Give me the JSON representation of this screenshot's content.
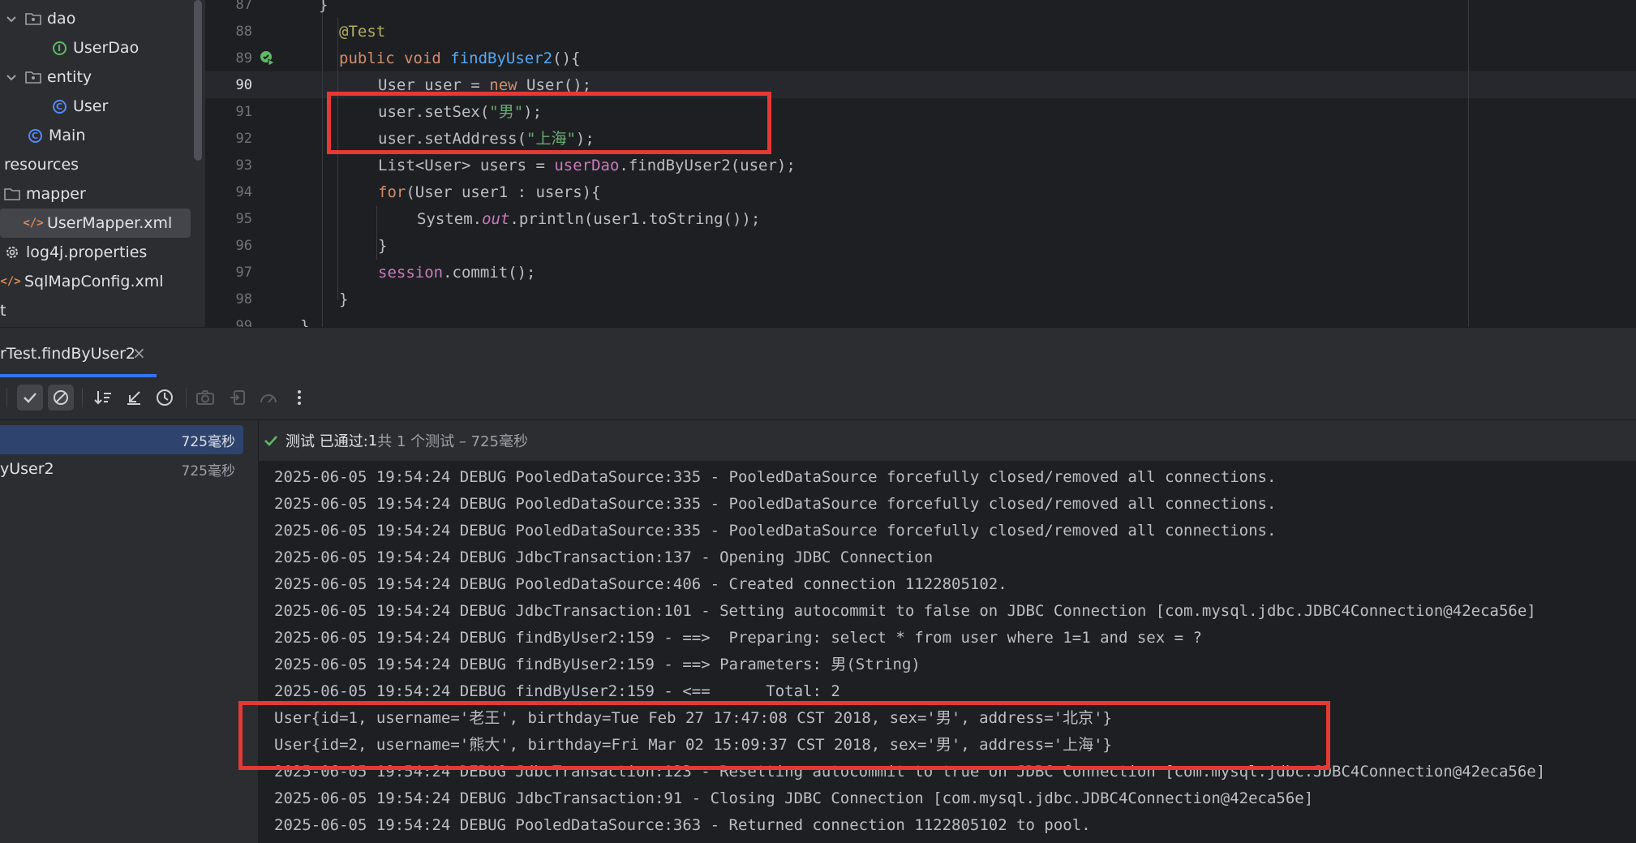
{
  "project_tree": {
    "items": [
      {
        "label": "dao",
        "icon": "package-folder-icon",
        "expanded": true
      },
      {
        "label": "UserDao",
        "icon": "interface-icon"
      },
      {
        "label": "entity",
        "icon": "package-folder-icon",
        "expanded": true
      },
      {
        "label": "User",
        "icon": "class-icon"
      },
      {
        "label": "Main",
        "icon": "runnable-class-icon"
      },
      {
        "label": "resources",
        "icon": "none"
      },
      {
        "label": "mapper",
        "icon": "folder-icon"
      },
      {
        "label": "UserMapper.xml",
        "icon": "xml-file-icon",
        "selected": true
      },
      {
        "label": "log4j.properties",
        "icon": "properties-gear-icon"
      },
      {
        "label": "SqlMapConfig.xml",
        "icon": "xml-file-icon"
      },
      {
        "label": "t",
        "icon": "none"
      }
    ]
  },
  "editor": {
    "line_numbers": [
      "87",
      "88",
      "89",
      "90",
      "91",
      "92",
      "93",
      "94",
      "95",
      "96",
      "97",
      "98",
      "99"
    ],
    "current_line": "90"
  },
  "code": {
    "l87": "}",
    "l88": "@Test",
    "l89_kw": "public void ",
    "l89_fn": "findByUser2",
    "l89_end": "(){",
    "l90_a": "User user = ",
    "l90_kw": "new ",
    "l90_b": "User();",
    "l91_a": "user.setSex(",
    "l91_s": "\"男\"",
    "l91_b": ");",
    "l92_a": "user.setAddress(",
    "l92_s": "\"上海\"",
    "l92_b": ");",
    "l93_a": "List<User> users = ",
    "l93_f": "userDao",
    "l93_b": ".findByUser2(user);",
    "l94_kw": "for",
    "l94_b": "(User user1 : users){",
    "l95_a": "System.",
    "l95_f": "out",
    "l95_b": ".println(user1.toString());",
    "l96": "}",
    "l97_f": "session",
    "l97_b": ".commit();",
    "l98": "}",
    "l99": "}"
  },
  "run_tab": {
    "label": "rTest.findByUser2",
    "close": "×"
  },
  "toolbar": {
    "icons": [
      "check-icon",
      "stop-circle-icon",
      "sort-icon",
      "collapse-icon",
      "clock-history-icon",
      "camera-icon",
      "import-icon",
      "gauge-icon",
      "more-vertical-icon"
    ]
  },
  "test_tree": {
    "rows": [
      {
        "label": "",
        "time": "725毫秒",
        "selected": true
      },
      {
        "label": "yUser2",
        "time": "725毫秒"
      }
    ]
  },
  "status": {
    "prefix": "测试 已通过: ",
    "count": "1",
    "suffix": "共 1 个测试 – 725毫秒"
  },
  "console": {
    "lines": [
      "2025-06-05 19:54:24 DEBUG PooledDataSource:335 - PooledDataSource forcefully closed/removed all connections.",
      "2025-06-05 19:54:24 DEBUG PooledDataSource:335 - PooledDataSource forcefully closed/removed all connections.",
      "2025-06-05 19:54:24 DEBUG PooledDataSource:335 - PooledDataSource forcefully closed/removed all connections.",
      "2025-06-05 19:54:24 DEBUG JdbcTransaction:137 - Opening JDBC Connection",
      "2025-06-05 19:54:24 DEBUG PooledDataSource:406 - Created connection 1122805102.",
      "2025-06-05 19:54:24 DEBUG JdbcTransaction:101 - Setting autocommit to false on JDBC Connection [com.mysql.jdbc.JDBC4Connection@42eca56e]",
      "2025-06-05 19:54:24 DEBUG findByUser2:159 - ==>  Preparing: select * from user where 1=1 and sex = ?",
      "2025-06-05 19:54:24 DEBUG findByUser2:159 - ==> Parameters: 男(String)",
      "2025-06-05 19:54:24 DEBUG findByUser2:159 - <==      Total: 2",
      "User{id=1, username='老王', birthday=Tue Feb 27 17:47:08 CST 2018, sex='男', address='北京'}",
      "User{id=2, username='熊大', birthday=Fri Mar 02 15:09:37 CST 2018, sex='男', address='上海'}",
      "2025-06-05 19:54:24 DEBUG JdbcTransaction:123 - Resetting autocommit to true on JDBC Connection [com.mysql.jdbc.JDBC4Connection@42eca56e]",
      "2025-06-05 19:54:24 DEBUG JdbcTransaction:91 - Closing JDBC Connection [com.mysql.jdbc.JDBC4Connection@42eca56e]",
      "2025-06-05 19:54:24 DEBUG PooledDataSource:363 - Returned connection 1122805102 to pool."
    ]
  },
  "colors": {
    "annotation_box": "#e53935",
    "pass_green": "#5fb865",
    "selection_blue": "#2e436e",
    "tab_underline": "#3574f0"
  }
}
